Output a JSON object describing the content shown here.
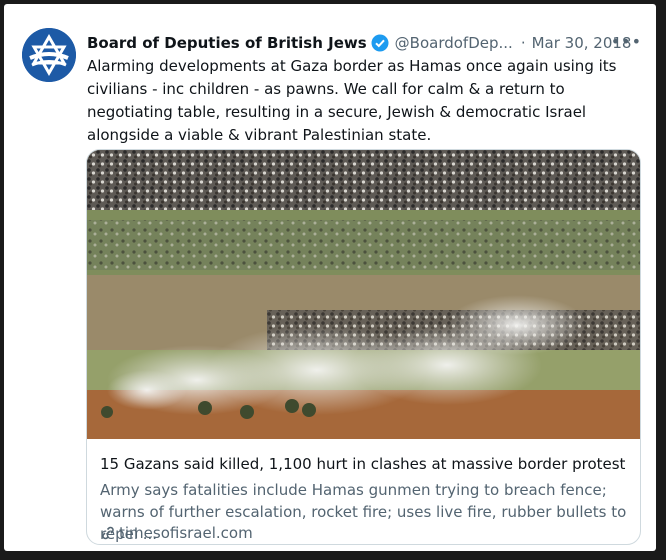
{
  "account": {
    "display_name": "Board of Deputies of British Jews",
    "handle": "@BoardofDep...",
    "separator": "·",
    "date": "Mar 30, 2018",
    "more_label": "•••"
  },
  "tweet": {
    "text": "Alarming developments at Gaza border as Hamas once again using its civilians - inc children - as pawns. We call for calm & a return to negotiating table, resulting in a secure, Jewish & democratic Israel alongside a viable & vibrant Palestinian state."
  },
  "link_card": {
    "title": "15 Gazans said killed, 1,100 hurt in clashes at massive border protest",
    "description": "Army says fatalities include Hamas gunmen trying to breach fence; warns of further escalation, rocket fire; uses live fire, rubber bullets to repel ...",
    "domain": "timesofisrael.com"
  },
  "colors": {
    "brand_blue": "#1d5aa6",
    "verified_blue": "#1d9bf0",
    "secondary_text": "#536471"
  },
  "icons": [
    "star-of-david-logo",
    "verified-badge-icon",
    "more-options-icon",
    "link-icon"
  ]
}
